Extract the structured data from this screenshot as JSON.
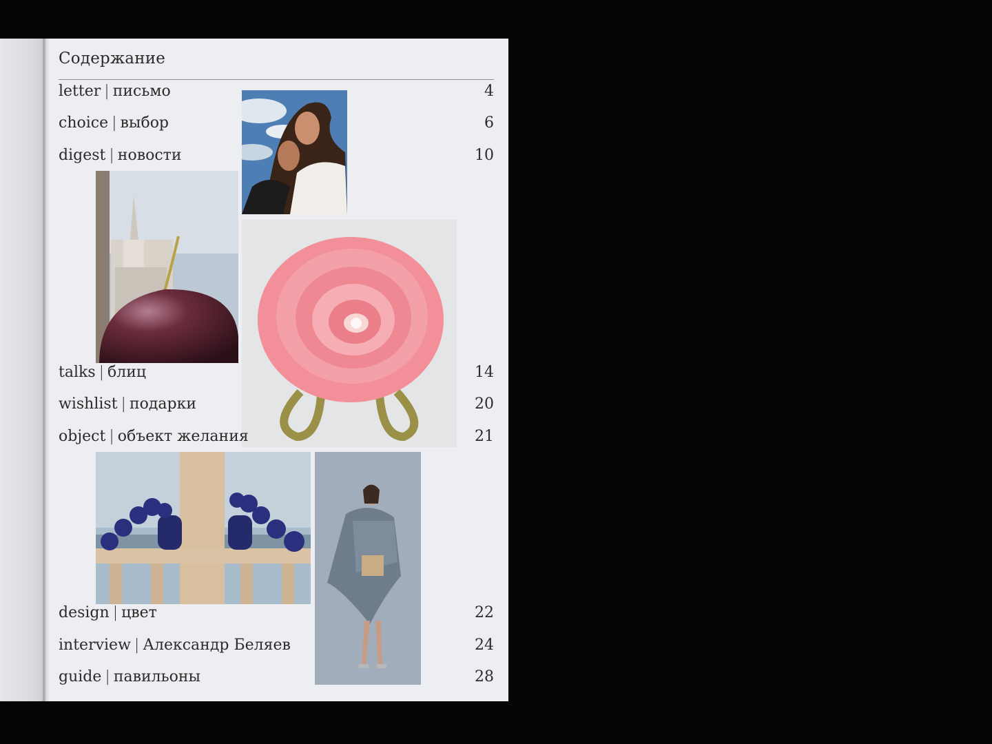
{
  "page": {
    "heading": "Содержание"
  },
  "toc": [
    {
      "en": "letter",
      "sep": "|",
      "ru": "письмо",
      "page": "4"
    },
    {
      "en": "choice",
      "sep": "|",
      "ru": "выбор",
      "page": "6"
    },
    {
      "en": "digest",
      "sep": "|",
      "ru": "новости",
      "page": "10"
    },
    {
      "en": "talks",
      "sep": "|",
      "ru": "блиц",
      "page": "14"
    },
    {
      "en": "wishlist",
      "sep": "|",
      "ru": "подарки",
      "page": "20"
    },
    {
      "en": "object",
      "sep": "|",
      "ru": "объект желания",
      "page": "21"
    },
    {
      "en": "design",
      "sep": "|",
      "ru": "цвет",
      "page": "22"
    },
    {
      "en": "interview",
      "sep": "|",
      "ru": "Александр Беляев",
      "page": "24"
    },
    {
      "en": "guide",
      "sep": "|",
      "ru": "павильоны",
      "page": "28"
    }
  ],
  "colors": {
    "background": "#050505",
    "paper": "#eceef1",
    "text": "#2b2b2b",
    "rose": "#ef8a93",
    "cherry": "#4a1f2c",
    "navy": "#2a2f6e"
  }
}
